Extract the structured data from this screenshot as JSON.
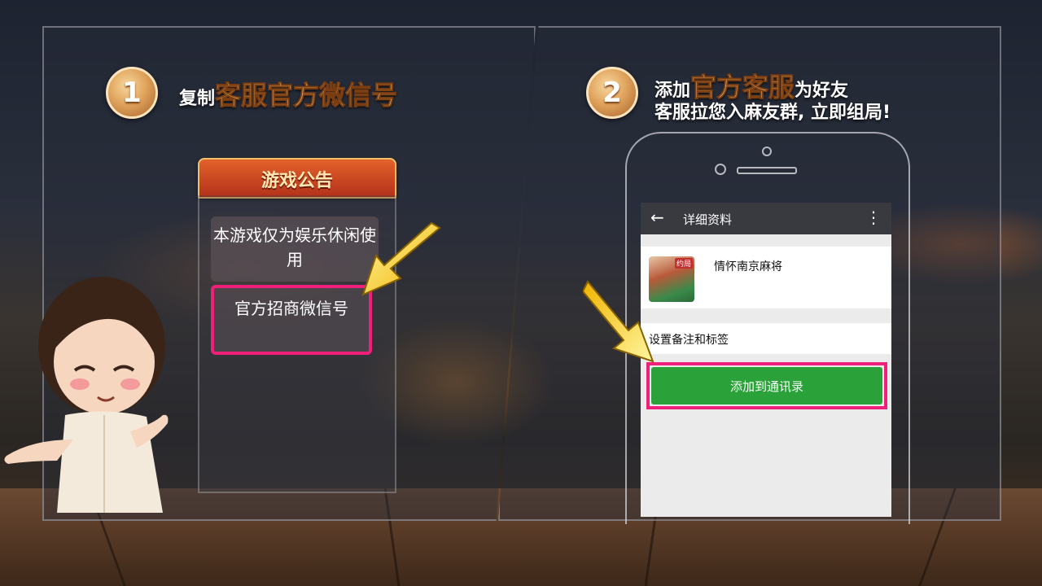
{
  "step1": {
    "number": "1",
    "prefix": "复制",
    "highlight": "客服官方微信号"
  },
  "notice": {
    "title": "游戏公告",
    "item1": "本游戏仅为娱乐休闲使用",
    "item2": "官方招商微信号"
  },
  "step2": {
    "number": "2",
    "prefix": "添加",
    "highlight": "官方客服",
    "suffix": "为好友",
    "line2": "客服拉您入麻友群, 立即组局!"
  },
  "phone": {
    "back_icon": "←",
    "title": "详细资料",
    "more_icon": "⋮",
    "profile_name": "情怀南京麻将",
    "avatar_badge": "约局",
    "remark_label": "设置备注和标签",
    "add_button": "添加到通讯录"
  },
  "colors": {
    "accent_pink": "#f0207a",
    "button_green": "#2ba13a",
    "step_gold": "#e0a45c"
  }
}
